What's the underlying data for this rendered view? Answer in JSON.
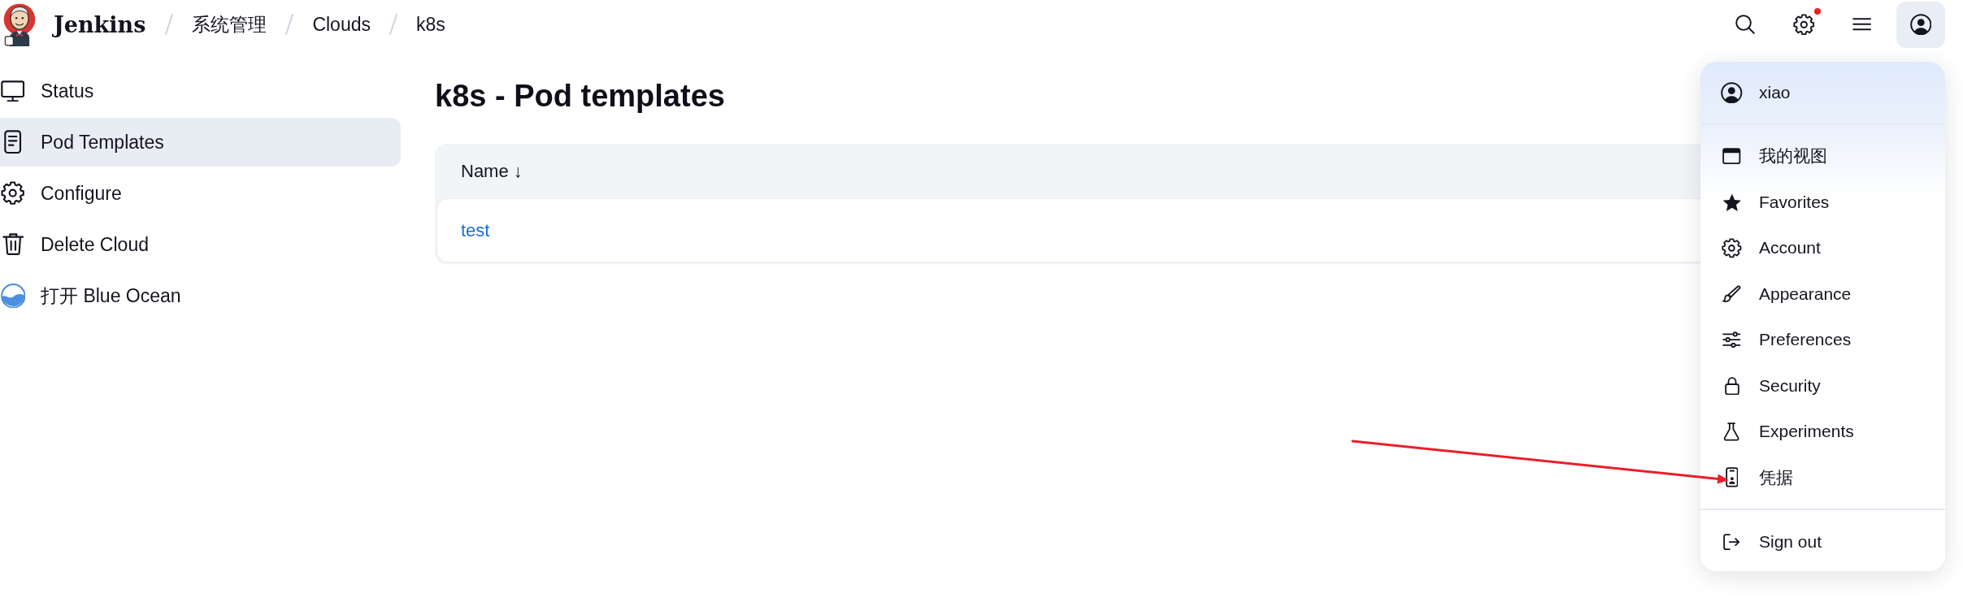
{
  "header": {
    "logo_text": "Jenkins",
    "breadcrumbs": [
      {
        "label": "系统管理"
      },
      {
        "label": "Clouds"
      },
      {
        "label": "k8s"
      }
    ],
    "actions": [
      {
        "kind": "search",
        "alert": false,
        "expanded": false
      },
      {
        "kind": "manage",
        "alert": true,
        "expanded": false
      },
      {
        "kind": "menu",
        "alert": false,
        "expanded": false
      },
      {
        "kind": "user",
        "alert": false,
        "expanded": true
      }
    ]
  },
  "sidebar": {
    "items": [
      {
        "kind": "status",
        "label": "Status",
        "selected": false
      },
      {
        "kind": "templates",
        "label": "Pod Templates",
        "selected": true
      },
      {
        "kind": "configure",
        "label": "Configure",
        "selected": false
      },
      {
        "kind": "delete",
        "label": "Delete Cloud",
        "selected": false
      },
      {
        "kind": "blueocean",
        "label": "打开 Blue Ocean",
        "selected": false
      }
    ]
  },
  "main": {
    "title": "k8s - Pod templates",
    "table": {
      "columns": [
        {
          "label": "Name",
          "sort_indicator": "↓"
        }
      ],
      "rows": [
        {
          "name": "test"
        }
      ]
    }
  },
  "user_menu": {
    "user": {
      "name": "xiao"
    },
    "items": [
      {
        "kind": "views",
        "label": "我的视图"
      },
      {
        "kind": "favorites",
        "label": "Favorites"
      },
      {
        "kind": "account",
        "label": "Account"
      },
      {
        "kind": "appearance",
        "label": "Appearance"
      },
      {
        "kind": "preferences",
        "label": "Preferences"
      },
      {
        "kind": "security",
        "label": "Security"
      },
      {
        "kind": "experiments",
        "label": "Experiments"
      },
      {
        "kind": "credentials",
        "label": "凭据"
      }
    ],
    "footer_items": [
      {
        "kind": "signout",
        "label": "Sign out"
      }
    ]
  },
  "annotations": [
    {
      "kind": "arrow"
    }
  ]
}
